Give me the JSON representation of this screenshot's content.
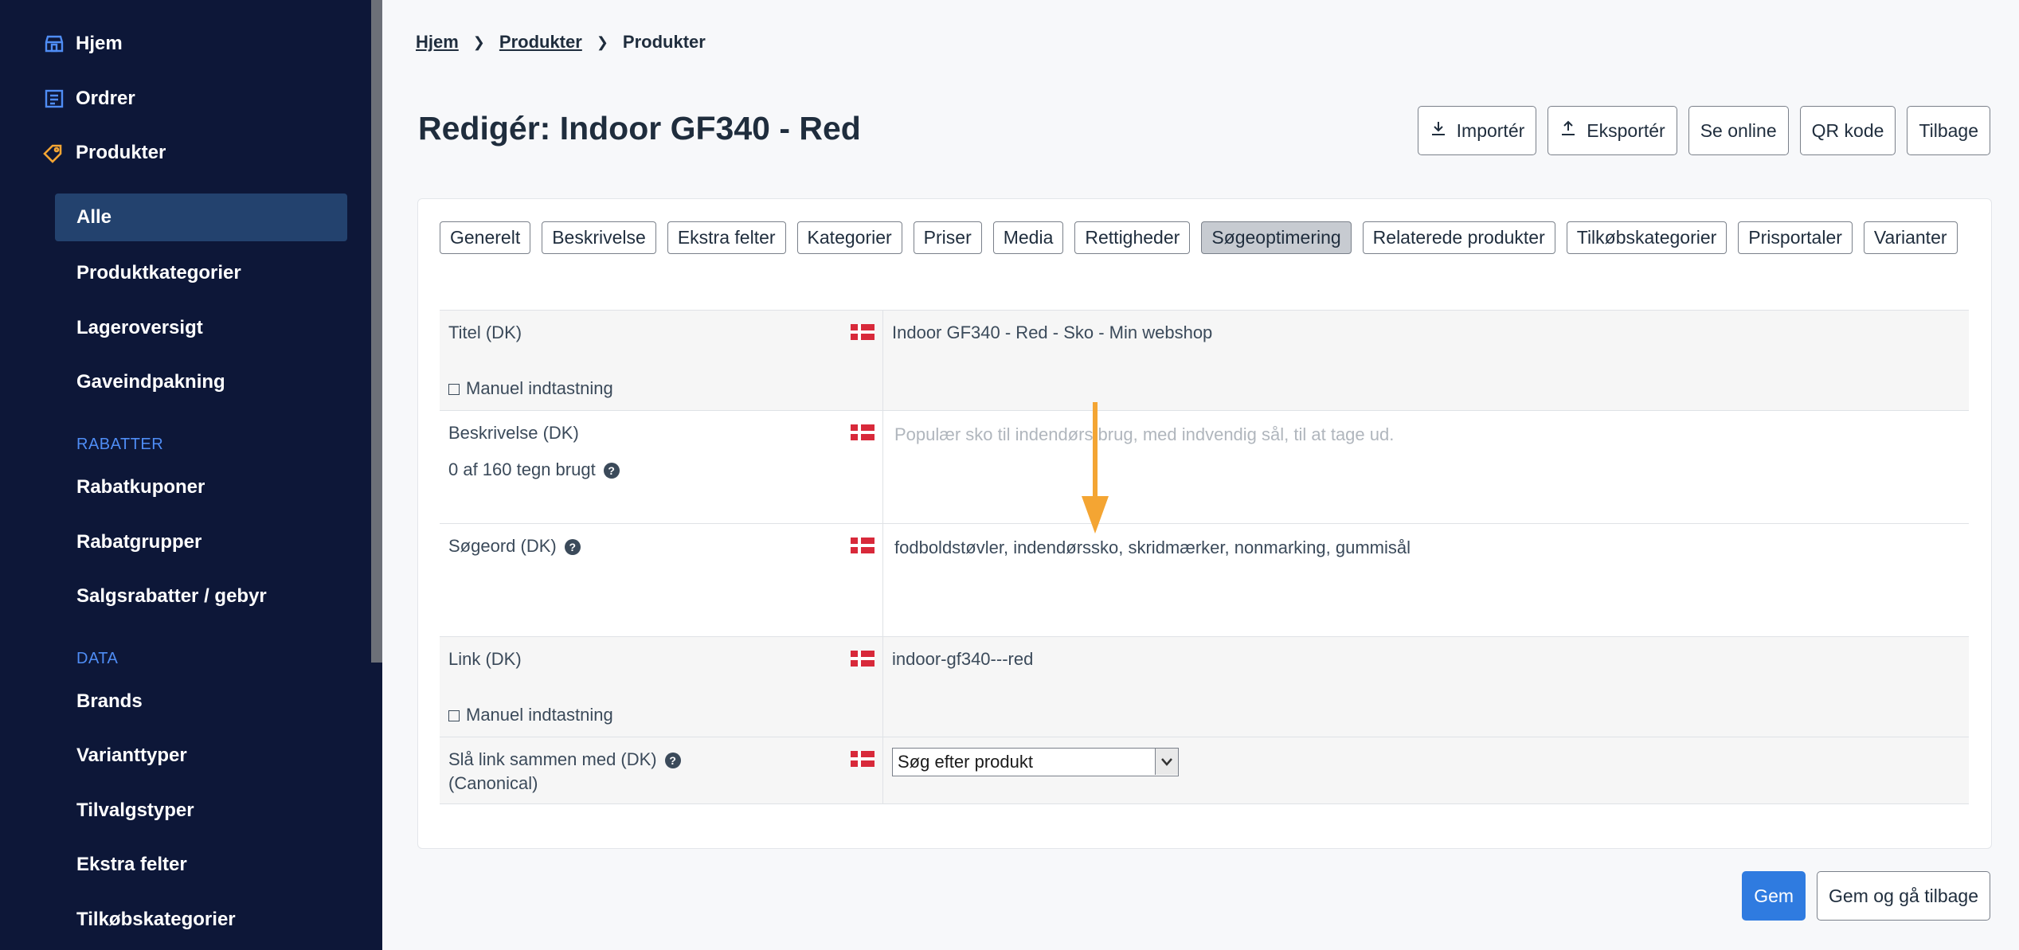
{
  "sidebar": {
    "top_items": [
      {
        "label": "Hjem",
        "icon": "home-icon"
      },
      {
        "label": "Ordrer",
        "icon": "orders-icon"
      },
      {
        "label": "Produkter",
        "icon": "tag-icon"
      }
    ],
    "products_sub": [
      "Alle",
      "Produktkategorier",
      "Lageroversigt",
      "Gaveindpakning"
    ],
    "section_rabatter": "RABATTER",
    "rabatter_items": [
      "Rabatkuponer",
      "Rabatgrupper",
      "Salgsrabatter / gebyr"
    ],
    "section_data": "DATA",
    "data_items": [
      "Brands",
      "Varianttyper",
      "Tilvalgstyper",
      "Ekstra felter",
      "Tilkøbskategorier"
    ],
    "active_item": "Alle"
  },
  "breadcrumb": [
    "Hjem",
    "Produkter",
    "Produkter"
  ],
  "page_title": "Redigér: Indoor GF340 - Red",
  "top_actions": {
    "import": "Importér",
    "export": "Eksportér",
    "online": "Se online",
    "qr": "QR kode",
    "back": "Tilbage"
  },
  "tabs": [
    "Generelt",
    "Beskrivelse",
    "Ekstra felter",
    "Kategorier",
    "Priser",
    "Media",
    "Rettigheder",
    "Søgeoptimering",
    "Relaterede produkter",
    "Tilkøbskategorier",
    "Prisportaler",
    "Varianter"
  ],
  "active_tab": "Søgeoptimering",
  "form": {
    "title_label": "Titel (DK)",
    "title_value": "Indoor GF340 - Red - Sko - Min webshop",
    "manual_label": "Manuel indtastning",
    "desc_label": "Beskrivelse (DK)",
    "desc_count": "0 af 160 tegn brugt",
    "desc_placeholder": "Populær sko til indendørs brug, med indvendig sål, til at tage ud.",
    "keywords_label": "Søgeord (DK)",
    "keywords_value": "fodboldstøvler, indendørssko, skridmærker, nonmarking, gummisål",
    "link_label": "Link (DK)",
    "link_value": "indoor-gf340---red",
    "canonical_label": "Slå link sammen med (DK)",
    "canonical_sub": "(Canonical)",
    "canonical_select": "Søg efter produkt"
  },
  "bottom_actions": {
    "save": "Gem",
    "save_back": "Gem og gå tilbage"
  },
  "colors": {
    "sidebar_bg": "#0d1738",
    "active_nav": "#23426e",
    "accent": "#2f7be0",
    "section_label": "#4f8df5",
    "annotation_arrow": "#f4a533"
  }
}
